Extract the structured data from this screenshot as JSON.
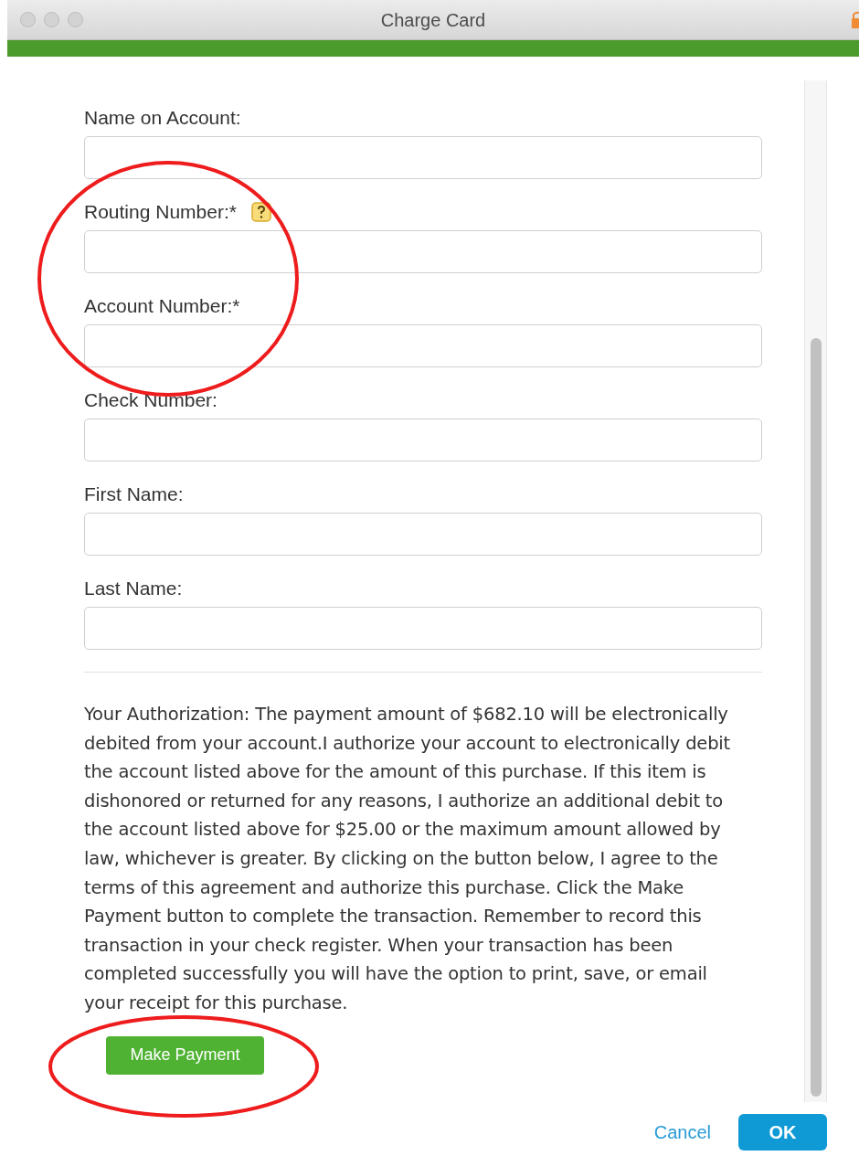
{
  "window": {
    "title": "Charge Card"
  },
  "fields": [
    {
      "label": "Name on Account:",
      "help": false
    },
    {
      "label": "Routing Number:*",
      "help": true
    },
    {
      "label": "Account Number:*",
      "help": false
    },
    {
      "label": "Check Number:",
      "help": false
    },
    {
      "label": "First Name:",
      "help": false
    },
    {
      "label": "Last Name:",
      "help": false
    }
  ],
  "authorization": "Your Authorization: The payment amount of $682.10 will be electronically debited from your account.I authorize your account to electronically debit the account listed above for the amount of this purchase. If this item is dishonored or returned for any reasons, I authorize an additional debit to the account listed above for $25.00 or the maximum amount allowed by law, whichever is greater. By clicking on the button below, I agree to the terms of this agreement and authorize this purchase. Click the Make Payment button to complete the transaction. Remember to record this transaction in your check register. When your transaction has been completed successfully you will have the option to print, save, or email your receipt for this purchase.",
  "make_payment_button": "Make Payment",
  "footer_buttons": [
    {
      "label": "Cancel",
      "kind": "link"
    },
    {
      "label": "OK",
      "kind": "primary"
    }
  ]
}
